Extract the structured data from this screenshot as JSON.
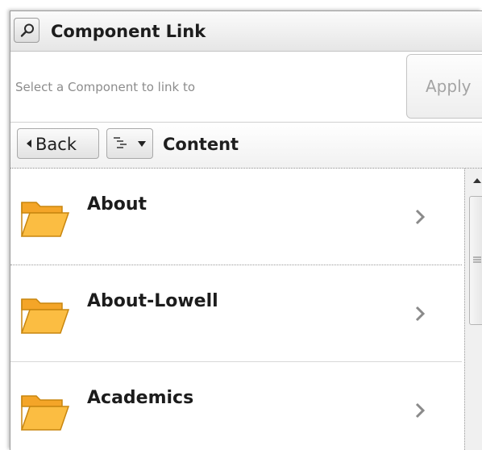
{
  "dialog": {
    "title": "Component Link",
    "search_icon": "search-icon"
  },
  "select": {
    "placeholder": "Select a Component to link to",
    "value": "",
    "apply_label": "Apply"
  },
  "nav": {
    "back_label": "Back",
    "tree_icon": "tree-view-icon",
    "current_folder": "Content"
  },
  "list": {
    "items": [
      {
        "label": "About",
        "icon": "folder-icon"
      },
      {
        "label": "About-Lowell",
        "icon": "folder-icon"
      },
      {
        "label": "Academics",
        "icon": "folder-icon"
      }
    ]
  },
  "colors": {
    "folder_fill": "#f9b83b",
    "folder_stroke": "#c8860f",
    "chevron": "#8a8a8a"
  }
}
